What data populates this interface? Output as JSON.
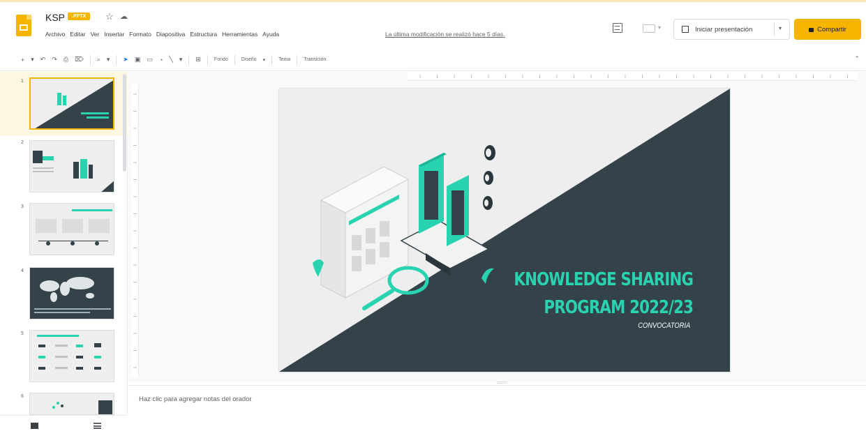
{
  "app": {
    "doc_title": "KSP",
    "file_badge": ".PPTX",
    "star_icon": "star-icon",
    "cloud_icon": "cloud-status-icon"
  },
  "menu": [
    "Archivo",
    "Editar",
    "Ver",
    "Insertar",
    "Formato",
    "Diapositiva",
    "Estructura",
    "Herramientas",
    "Ayuda"
  ],
  "last_edit": "La última modificación se realizó hace 5 días.",
  "actions": {
    "present_label": "Iniciar presentación",
    "share_label": "Compartir"
  },
  "toolbar": {
    "icons": [
      "add-icon",
      "undo-icon",
      "redo-icon",
      "print-icon",
      "paint-format-icon",
      "zoom-icon",
      "select-icon",
      "textbox-icon",
      "image-icon",
      "shape-icon",
      "line-icon",
      "comment-icon"
    ],
    "fondo": "Fondo",
    "diseno": "Diseño",
    "tema": "Tema",
    "transicion": "Transición"
  },
  "slides": {
    "numbers": [
      "1",
      "2",
      "3",
      "4",
      "5",
      "6"
    ],
    "current": 1
  },
  "slide": {
    "title_line1": "KNOWLEDGE SHARING",
    "title_line2": "PROGRAM 2022/23",
    "subtitle": "CONVOCATORIA",
    "colors": {
      "dark": "#34434a",
      "accent": "#29d3b0",
      "bg": "#eeeeee"
    }
  },
  "notes_placeholder": "Haz clic para agregar notas del orador",
  "colors": {
    "brand": "#f4b400"
  }
}
